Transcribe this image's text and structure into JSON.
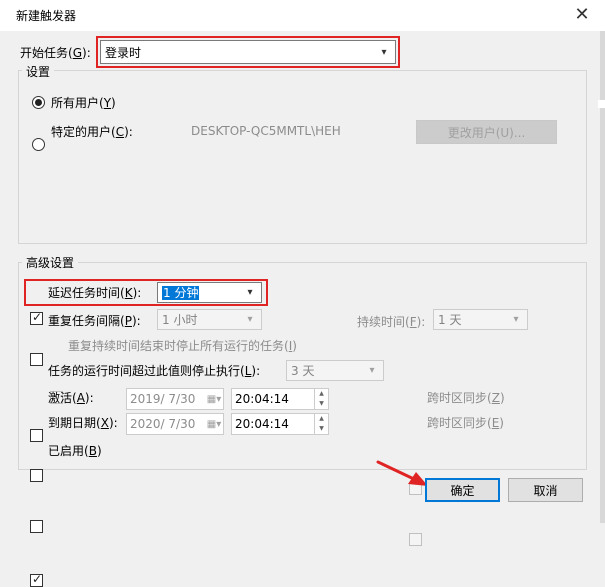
{
  "dialog": {
    "title": "新建触发器",
    "close_glyph": "✕"
  },
  "begin_task": {
    "label": "开始任务",
    "accel": "(G)",
    "accel_key": "G",
    "value": "登录时"
  },
  "settings": {
    "legend": "设置",
    "all_users": {
      "label": "所有用户",
      "accel": "Y",
      "selected": true
    },
    "specific_user": {
      "label": "特定的用户",
      "accel": "C",
      "selected": false
    },
    "user_name": "DESKTOP-QC5MMTL\\HEH",
    "change_user_button": "更改用户(U)..."
  },
  "advanced": {
    "legend": "高级设置",
    "delay": {
      "label": "延迟任务时间",
      "accel": "K",
      "checked": true,
      "value": "1 分钟"
    },
    "repeat": {
      "label": "重复任务间隔",
      "accel": "P",
      "checked": false,
      "value": "1 小时"
    },
    "duration": {
      "label": "持续时间",
      "accel": "F",
      "value": "1 天"
    },
    "stop_all": {
      "label": "重复持续时间结束时停止所有运行的任务",
      "accel": "I"
    },
    "stop_if_longer": {
      "label": "任务的运行时间超过此值则停止执行",
      "accel": "L",
      "checked": false,
      "value": "3 天"
    },
    "activate": {
      "label": "激活",
      "accel": "A",
      "date": "2019/ 7/30",
      "time": "20:04:14",
      "sync_label": "跨时区同步",
      "sync_accel": "Z"
    },
    "expire": {
      "label": "到期日期",
      "accel": "X",
      "date": "2020/ 7/30",
      "time": "20:04:14",
      "sync_label": "跨时区同步",
      "sync_accel": "E"
    },
    "enabled": {
      "label": "已启用",
      "accel": "B",
      "checked": true
    }
  },
  "buttons": {
    "ok": "确定",
    "cancel": "取消"
  },
  "icons": {
    "dropdown": "chevron-down-icon",
    "calendar": "calendar-icon",
    "spin": "spin-arrows-icon",
    "annotation": "red-arrow-icon"
  },
  "colors": {
    "highlight": "#e02424",
    "accent": "#0078d7"
  }
}
